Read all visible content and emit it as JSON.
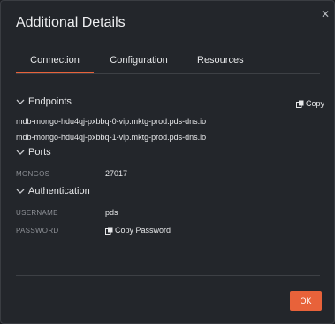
{
  "dialog": {
    "title": "Additional Details",
    "close_icon": "close-icon"
  },
  "tabs": [
    {
      "label": "Connection",
      "active": true
    },
    {
      "label": "Configuration",
      "active": false
    },
    {
      "label": "Resources",
      "active": false
    }
  ],
  "endpoints": {
    "header": "Endpoints",
    "copy_label": "Copy",
    "items": [
      "mdb-mongo-hdu4qj-pxbbq-0-vip.mktg-prod.pds-dns.io",
      "mdb-mongo-hdu4qj-pxbbq-1-vip.mktg-prod.pds-dns.io"
    ]
  },
  "ports": {
    "header": "Ports",
    "items": [
      {
        "key": "MONGOS",
        "value": "27017"
      }
    ]
  },
  "authentication": {
    "header": "Authentication",
    "username_key": "USERNAME",
    "username_value": "pds",
    "password_key": "PASSWORD",
    "copy_password_label": "Copy Password"
  },
  "footer": {
    "ok_label": "OK"
  },
  "colors": {
    "accent": "#e8623a",
    "background": "#23262b"
  }
}
